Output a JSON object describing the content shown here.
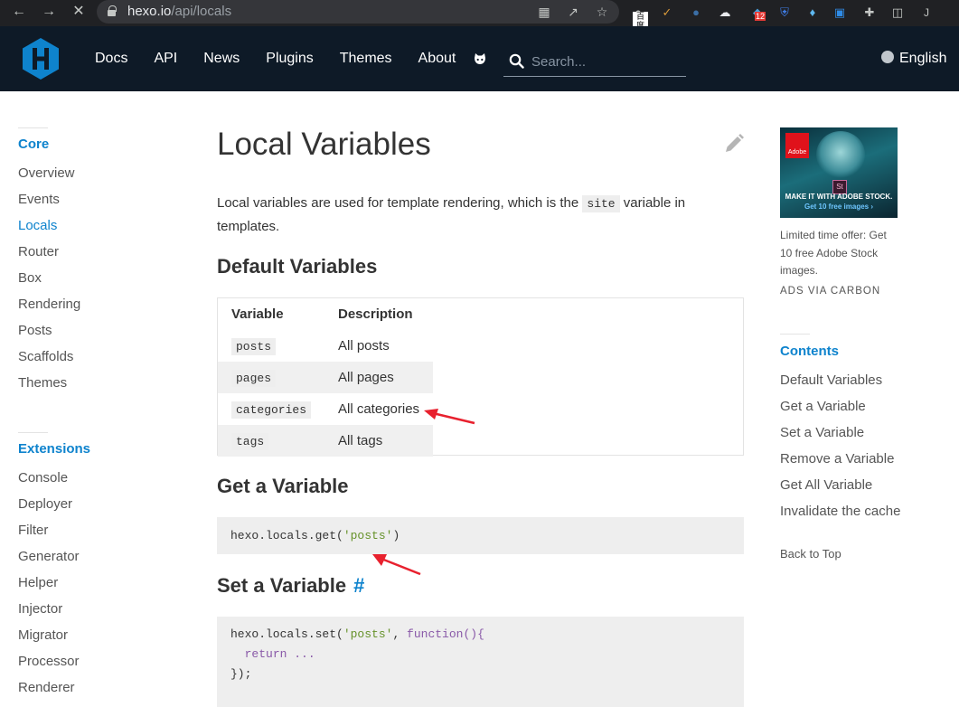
{
  "browser": {
    "url_host": "hexo.io",
    "url_path": "/api/locals",
    "extensions": {
      "baidu_badge": "百度",
      "notification_badge": "12",
      "profile_initial": "J"
    }
  },
  "site_header": {
    "nav": [
      "Docs",
      "API",
      "News",
      "Plugins",
      "Themes",
      "About"
    ],
    "search_placeholder": "Search...",
    "language": "English"
  },
  "sidebar": {
    "sections": [
      {
        "title": "Core",
        "items": [
          "Overview",
          "Events",
          "Locals",
          "Router",
          "Box",
          "Rendering",
          "Posts",
          "Scaffolds",
          "Themes"
        ]
      },
      {
        "title": "Extensions",
        "items": [
          "Console",
          "Deployer",
          "Filter",
          "Generator",
          "Helper",
          "Injector",
          "Migrator",
          "Processor",
          "Renderer"
        ]
      }
    ],
    "active_item": "Locals"
  },
  "main": {
    "title": "Local Variables",
    "intro_before": "Local variables are used for template rendering, which is the ",
    "intro_code": "site",
    "intro_after": " variable in templates.",
    "default_variables": {
      "heading": "Default Variables",
      "columns": [
        "Variable",
        "Description"
      ],
      "rows": [
        {
          "variable": "posts",
          "description": "All posts"
        },
        {
          "variable": "pages",
          "description": "All pages"
        },
        {
          "variable": "categories",
          "description": "All categories"
        },
        {
          "variable": "tags",
          "description": "All tags"
        }
      ]
    },
    "get_variable": {
      "heading": "Get a Variable",
      "code": {
        "prefix": "hexo.locals.get(",
        "string": "'posts'",
        "suffix": ")"
      }
    },
    "set_variable": {
      "heading": "Set a Variable",
      "anchor": "#",
      "code": {
        "line1_prefix": "hexo.locals.set(",
        "line1_string": "'posts'",
        "line1_mid": ", ",
        "line1_keyword": "function",
        "line1_suffix": "(){",
        "line2_keyword": "return",
        "line2_rest": " ...",
        "line3": "});"
      }
    }
  },
  "right_sidebar": {
    "ad": {
      "headline": "MAKE IT WITH ADOBE STOCK.",
      "cta": "Get 10 free images ›",
      "logo_text": "Adobe",
      "app_badge": "St",
      "text": "Limited time offer: Get 10 free Adobe Stock images.",
      "via": "ADS VIA CARBON"
    },
    "contents": {
      "title": "Contents",
      "items": [
        "Default Variables",
        "Get a Variable",
        "Set a Variable",
        "Remove a Variable",
        "Get All Variable",
        "Invalidate the cache"
      ]
    },
    "back_to_top": "Back to Top"
  },
  "colors": {
    "header_bg": "#0e1a27",
    "accent": "#0e83cd",
    "annotation_arrow": "#e8212e"
  }
}
